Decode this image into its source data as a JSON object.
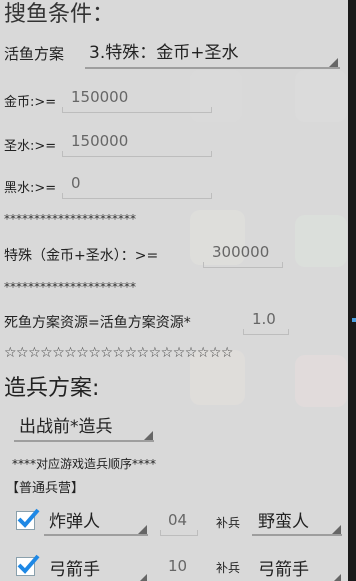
{
  "colors": {
    "accent": "#1e88e5",
    "checkbox": "#1e88e5"
  },
  "section_search": {
    "title": "搜鱼条件："
  },
  "live_fish": {
    "label": "活鱼方案",
    "selected": "3.特殊：金币+圣水"
  },
  "gold": {
    "label": "金币:>=",
    "value": "150000"
  },
  "elixir": {
    "label": "圣水:>=",
    "value": "150000"
  },
  "dark": {
    "label": "黑水:>=",
    "value": "0"
  },
  "sep1": "**********************",
  "special": {
    "label": "特殊（金币+圣水）：>=",
    "value": "300000"
  },
  "sep2": "**********************",
  "dead_fish": {
    "label": "死鱼方案资源=活鱼方案资源*",
    "value": "1.0"
  },
  "stars": "☆☆☆☆☆☆☆☆☆☆☆☆☆☆☆☆☆☆☆",
  "section_troops": {
    "title": "造兵方案:"
  },
  "troop_mode": {
    "selected": "出战前*造兵"
  },
  "order_note": "****对应游戏造兵顺序****",
  "barracks": "【普通兵营】",
  "rows": [
    {
      "checked": true,
      "unit": "炸弹人",
      "count": "04",
      "fill_label": "补兵",
      "fill_unit": "野蛮人"
    },
    {
      "checked": true,
      "unit": "弓箭手",
      "count": "10",
      "fill_label": "补兵",
      "fill_unit": "弓箭手"
    }
  ]
}
